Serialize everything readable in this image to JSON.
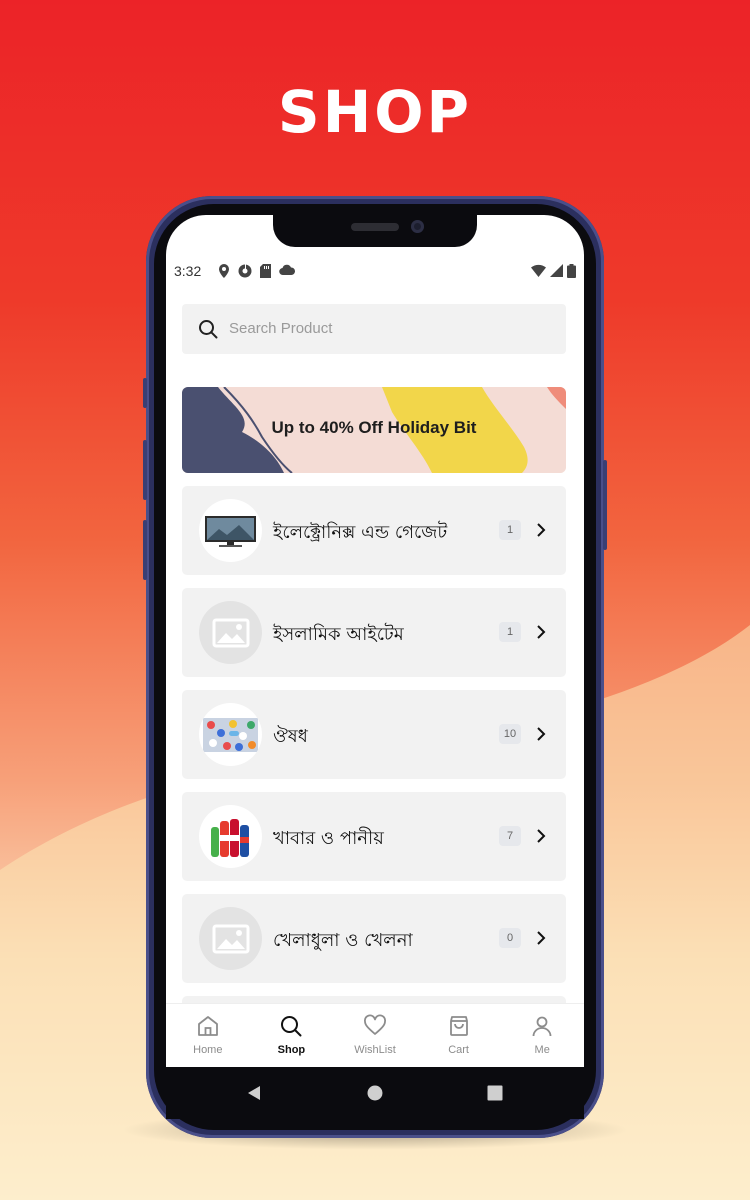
{
  "page": {
    "title": "SHOP"
  },
  "status_bar": {
    "time": "3:32",
    "left_icons": [
      "location-icon",
      "app-notification-icon",
      "sd-card-icon",
      "cloud-icon"
    ],
    "right_icons": [
      "wifi-icon",
      "signal-icon",
      "battery-icon"
    ]
  },
  "search": {
    "placeholder": "Search Product",
    "icon": "search-icon"
  },
  "banner": {
    "text": "Up to 40% Off Holiday Bit"
  },
  "categories": [
    {
      "label": "ইলেক্ট্রোনিক্স এন্ড গেজেট",
      "count": "1",
      "thumb": "tv"
    },
    {
      "label": "ইসলামিক আইটেম",
      "count": "1",
      "thumb": "placeholder"
    },
    {
      "label": "ঔষধ",
      "count": "10",
      "thumb": "pills"
    },
    {
      "label": "খাবার ও পানীয়",
      "count": "7",
      "thumb": "drinks"
    },
    {
      "label": "খেলাধুলা ও খেলনা",
      "count": "0",
      "thumb": "placeholder"
    }
  ],
  "bottom_nav": {
    "items": [
      {
        "label": "Home",
        "icon": "home-icon"
      },
      {
        "label": "Shop",
        "icon": "search-icon",
        "active": true
      },
      {
        "label": "WishList",
        "icon": "heart-icon"
      },
      {
        "label": "Cart",
        "icon": "cart-icon"
      },
      {
        "label": "Me",
        "icon": "user-icon"
      }
    ]
  },
  "colors": {
    "brand_red": "#ec2328",
    "card_bg": "#f2f2f2",
    "banner_navy": "#4a5070",
    "banner_yellow": "#f2d64a",
    "banner_pink": "#f4dcd5"
  }
}
